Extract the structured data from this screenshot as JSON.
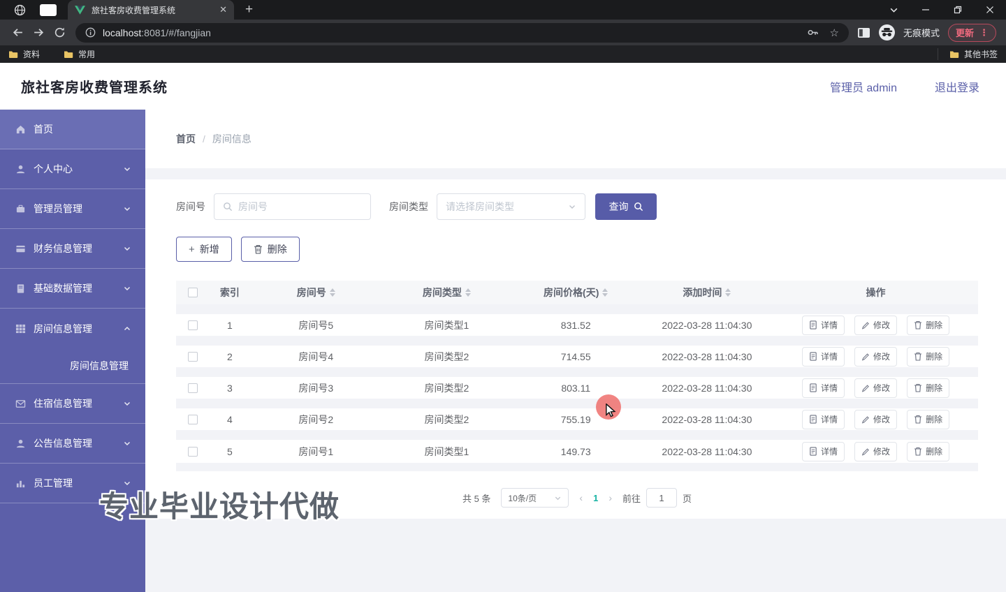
{
  "colors": {
    "sidebar": "#5c5fa9",
    "sidebar_active": "#6a6eb4",
    "primary": "#575ca8",
    "pagination_active": "#17b3a3",
    "cursor_highlight": "#ee6f6c",
    "update_button": "#f06a7e"
  },
  "browser": {
    "tab_title": "旅社客房收费管理系统",
    "url_host": "localhost",
    "url_rest": ":8081/#/fangjian",
    "incognito_label": "无痕模式",
    "update_label": "更新",
    "bookmarks": [
      "资料",
      "常用"
    ],
    "other_bookmarks": "其他书签"
  },
  "app_header": {
    "title": "旅社客房收费管理系统",
    "user": "管理员 admin",
    "logout": "退出登录"
  },
  "sidebar": {
    "items": [
      {
        "label": "首页",
        "icon": "home",
        "active": true
      },
      {
        "label": "个人中心",
        "icon": "user",
        "chevron": "down"
      },
      {
        "label": "管理员管理",
        "icon": "briefcase",
        "chevron": "down"
      },
      {
        "label": "财务信息管理",
        "icon": "bank-card",
        "chevron": "down"
      },
      {
        "label": "基础数据管理",
        "icon": "notebook",
        "chevron": "down"
      },
      {
        "label": "房间信息管理",
        "icon": "grid",
        "chevron": "up",
        "expanded": true,
        "children": [
          {
            "label": "房间信息管理",
            "active": true
          }
        ]
      },
      {
        "label": "住宿信息管理",
        "icon": "envelope",
        "chevron": "down"
      },
      {
        "label": "公告信息管理",
        "icon": "user",
        "chevron": "down"
      },
      {
        "label": "员工管理",
        "icon": "bar-chart",
        "chevron": "down"
      }
    ]
  },
  "breadcrumb": {
    "home": "首页",
    "separator": "/",
    "current": "房间信息"
  },
  "filters": {
    "room_label": "房间号",
    "room_placeholder": "房间号",
    "type_label": "房间类型",
    "type_placeholder": "请选择房间类型",
    "search_label": "查询"
  },
  "toolbar": {
    "add_label": "新增",
    "delete_label": "删除"
  },
  "table": {
    "columns": [
      {
        "label": "索引",
        "sortable": false
      },
      {
        "label": "房间号",
        "sortable": true
      },
      {
        "label": "房间类型",
        "sortable": true
      },
      {
        "label": "房间价格(天)",
        "sortable": true
      },
      {
        "label": "添加时间",
        "sortable": true
      },
      {
        "label": "操作",
        "sortable": false
      }
    ],
    "rows": [
      {
        "index": "1",
        "room": "房间号5",
        "type": "房间类型1",
        "price": "831.52",
        "time": "2022-03-28 11:04:30"
      },
      {
        "index": "2",
        "room": "房间号4",
        "type": "房间类型2",
        "price": "714.55",
        "time": "2022-03-28 11:04:30"
      },
      {
        "index": "3",
        "room": "房间号3",
        "type": "房间类型2",
        "price": "803.11",
        "time": "2022-03-28 11:04:30"
      },
      {
        "index": "4",
        "room": "房间号2",
        "type": "房间类型2",
        "price": "755.19",
        "time": "2022-03-28 11:04:30"
      },
      {
        "index": "5",
        "room": "房间号1",
        "type": "房间类型1",
        "price": "149.73",
        "time": "2022-03-28 11:04:30"
      }
    ],
    "row_actions": [
      {
        "label": "详情",
        "icon": "document"
      },
      {
        "label": "修改",
        "icon": "edit"
      },
      {
        "label": "删除",
        "icon": "trash"
      }
    ]
  },
  "pagination": {
    "total": "共 5 条",
    "page_size": "10条/页",
    "current": "1",
    "goto_label": "前往",
    "goto_value": "1",
    "page_unit": "页"
  },
  "watermark": "专业毕业设计代做"
}
